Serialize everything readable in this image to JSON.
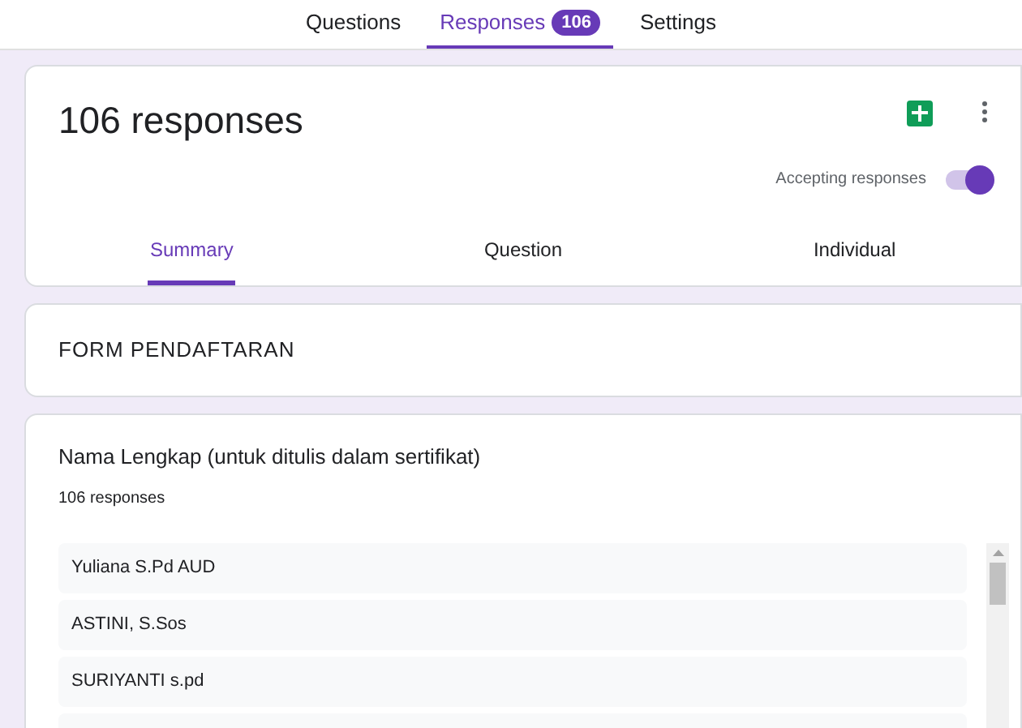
{
  "top_tabs": [
    {
      "label": "Questions",
      "selected": false
    },
    {
      "label": "Responses",
      "selected": true,
      "badge": "106"
    },
    {
      "label": "Settings",
      "selected": false
    }
  ],
  "header": {
    "title": "106 responses",
    "accepting": {
      "label": "Accepting responses",
      "on": true
    }
  },
  "view_tabs": [
    {
      "label": "Summary",
      "selected": true
    },
    {
      "label": "Question",
      "selected": false
    },
    {
      "label": "Individual",
      "selected": false
    }
  ],
  "form_title": "FORM PENDAFTARAN",
  "question": {
    "title": "Nama Lengkap (untuk ditulis dalam sertifikat)",
    "count": "106 responses",
    "answers": [
      "Yuliana S.Pd AUD",
      "ASTINI, S.Sos",
      "SURIYANTI s.pd"
    ]
  }
}
